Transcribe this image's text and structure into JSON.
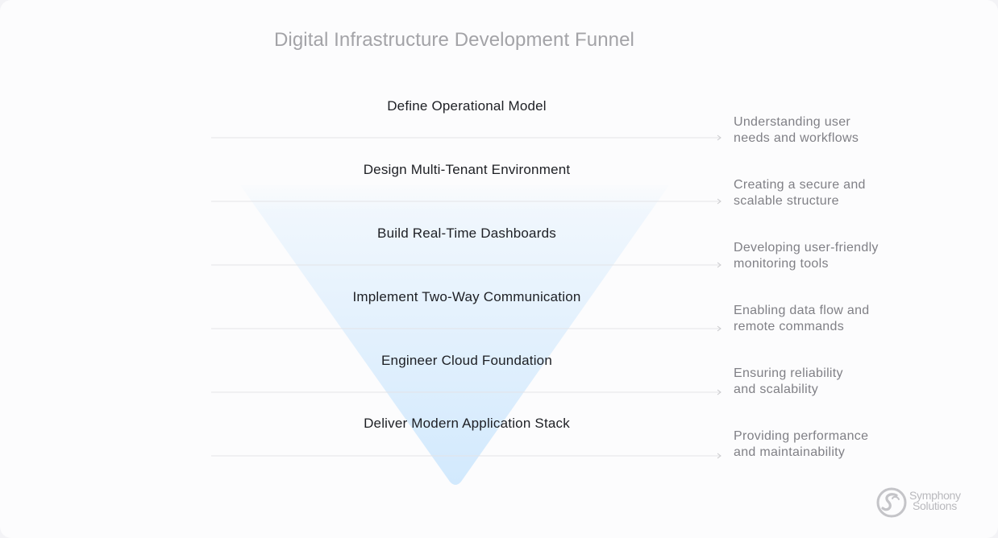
{
  "title": "Digital Infrastructure Development Funnel",
  "colors": {
    "funnel_top": "#eef6fd",
    "funnel_bottom": "#d3eafd",
    "line": "#e3e3e6",
    "label": "#1d1f24",
    "description": "#808086",
    "title": "#a3a3a7"
  },
  "stages": [
    {
      "label": "Define Operational Model",
      "description_line1": "Understanding user",
      "description_line2": "needs and workflows"
    },
    {
      "label": "Design Multi-Tenant Environment",
      "description_line1": "Creating a secure and",
      "description_line2": "scalable structure"
    },
    {
      "label": "Build Real-Time Dashboards",
      "description_line1": "Developing user-friendly",
      "description_line2": "monitoring tools"
    },
    {
      "label": "Implement Two-Way Communication",
      "description_line1": "Enabling data flow and",
      "description_line2": "remote commands"
    },
    {
      "label": "Engineer Cloud Foundation",
      "description_line1": "Ensuring reliability",
      "description_line2": "and scalability"
    },
    {
      "label": "Deliver Modern Application Stack",
      "description_line1": "Providing performance",
      "description_line2": "and maintainability"
    }
  ],
  "logo": {
    "icon": "symphony-solutions-logo-icon",
    "line1": "Symphony",
    "line2": "Solutions"
  }
}
